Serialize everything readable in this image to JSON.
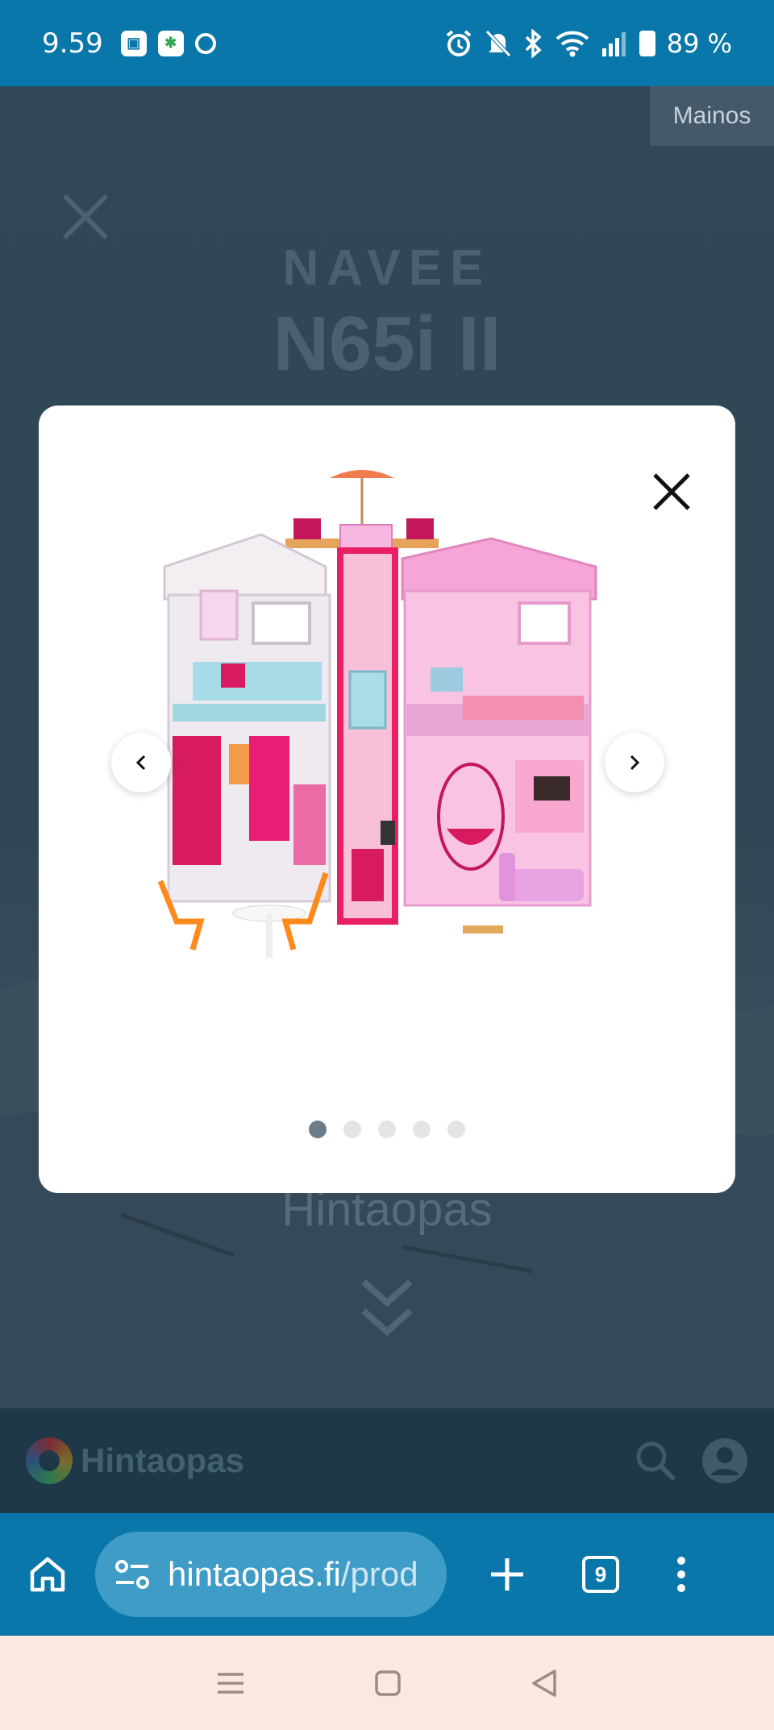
{
  "status_bar": {
    "time": "9.59",
    "battery": "89 %"
  },
  "ad": {
    "label": "Mainos",
    "brand": "NAVEE",
    "model": "N65i II",
    "footer": "Hintaopas"
  },
  "site": {
    "logo_text": "Hintaopas"
  },
  "browser": {
    "url_host": "hintaopas.fi",
    "url_path": "/prod",
    "tab_count": "9"
  },
  "gallery": {
    "image_count": 5,
    "active_index": 0
  }
}
